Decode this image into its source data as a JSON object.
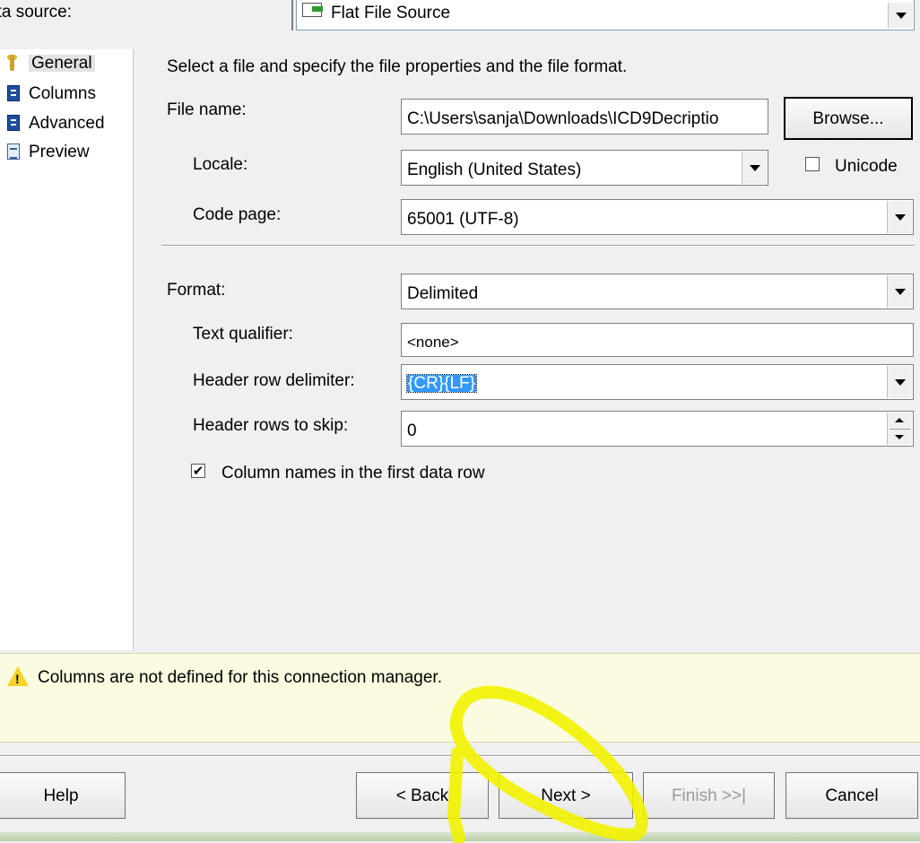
{
  "header": {
    "data_source_label": "ata source:",
    "data_source_value": "Flat File Source"
  },
  "nav": {
    "items": [
      {
        "label": "General",
        "icon": "wrench-icon",
        "selected": true
      },
      {
        "label": "Columns",
        "icon": "document-icon"
      },
      {
        "label": "Advanced",
        "icon": "document-icon"
      },
      {
        "label": "Preview",
        "icon": "preview-icon"
      }
    ]
  },
  "general": {
    "instruction": "Select a file and specify the file properties and the file format.",
    "file_name_label": "File name:",
    "file_name_value": "C:\\Users\\sanja\\Downloads\\ICD9Decriptio",
    "browse_label": "Browse...",
    "locale_label": "Locale:",
    "locale_value": "English (United States)",
    "unicode_label": "Unicode",
    "unicode_checked": false,
    "code_page_label": "Code page:",
    "code_page_value": "65001 (UTF-8)",
    "format_label": "Format:",
    "format_value": "Delimited",
    "text_qualifier_label": "Text qualifier:",
    "text_qualifier_value": "<none>",
    "header_row_delimiter_label": "Header row delimiter:",
    "header_row_delimiter_value": "{CR}{LF}",
    "header_rows_to_skip_label": "Header rows to skip:",
    "header_rows_to_skip_value": "0",
    "column_names_label": "Column names in the first data row",
    "column_names_checked": true
  },
  "warning": {
    "message": "Columns are not defined for this connection manager.",
    "icon": "warning-icon"
  },
  "buttons": {
    "help": "Help",
    "back": "< Back",
    "next": "Next >",
    "finish": "Finish >>|",
    "cancel": "Cancel"
  },
  "colors": {
    "warning_bg": "#fbfbe0",
    "selection": "#3399ff",
    "annotation": "#f2f200"
  }
}
